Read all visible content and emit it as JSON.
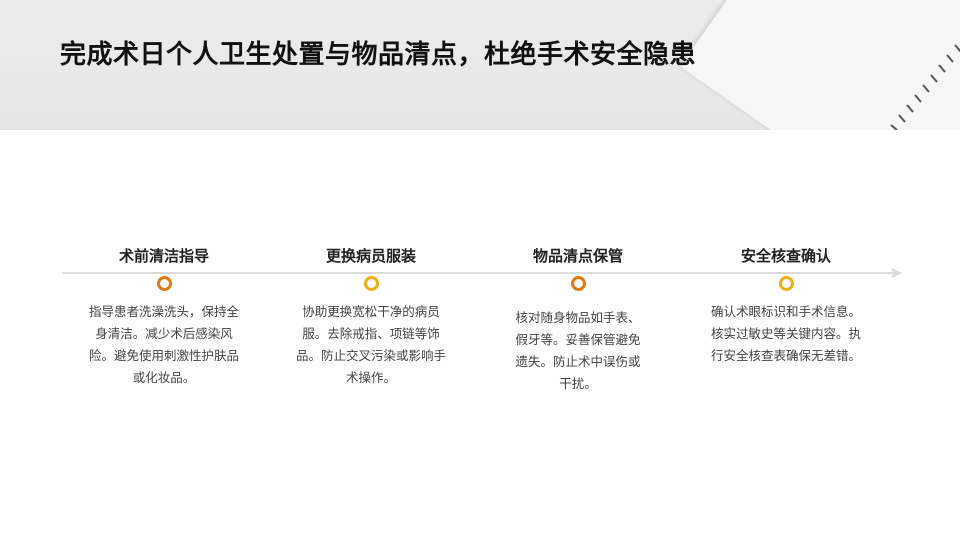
{
  "title": "完成术日个人卫生处置与物品清点，杜绝手术安全隐患",
  "colors": {
    "dot_orange": "#e07b12",
    "dot_yellow": "#f0b014",
    "line": "#dcdcdc"
  },
  "steps": [
    {
      "heading": "术前清洁指导",
      "desc": "指导患者洗澡洗头，保持全身清洁。减少术后感染风险。避免使用刺激性护肤品或化妆品。",
      "dot_color": "#e07b12"
    },
    {
      "heading": "更换病员服装",
      "desc": "协助更换宽松干净的病员服。去除戒指、项链等饰品。防止交叉污染或影响手术操作。",
      "dot_color": "#f0b014"
    },
    {
      "heading": "物品清点保管",
      "desc": "核对随身物品如手表、假牙等。妥善保管避免遗失。防止术中误伤或干扰。",
      "dot_color": "#e07b12"
    },
    {
      "heading": "安全核查确认",
      "desc": "确认术眼标识和手术信息。核实过敏史等关键内容。执行安全核查表确保无差错。",
      "dot_color": "#f0b014"
    }
  ]
}
